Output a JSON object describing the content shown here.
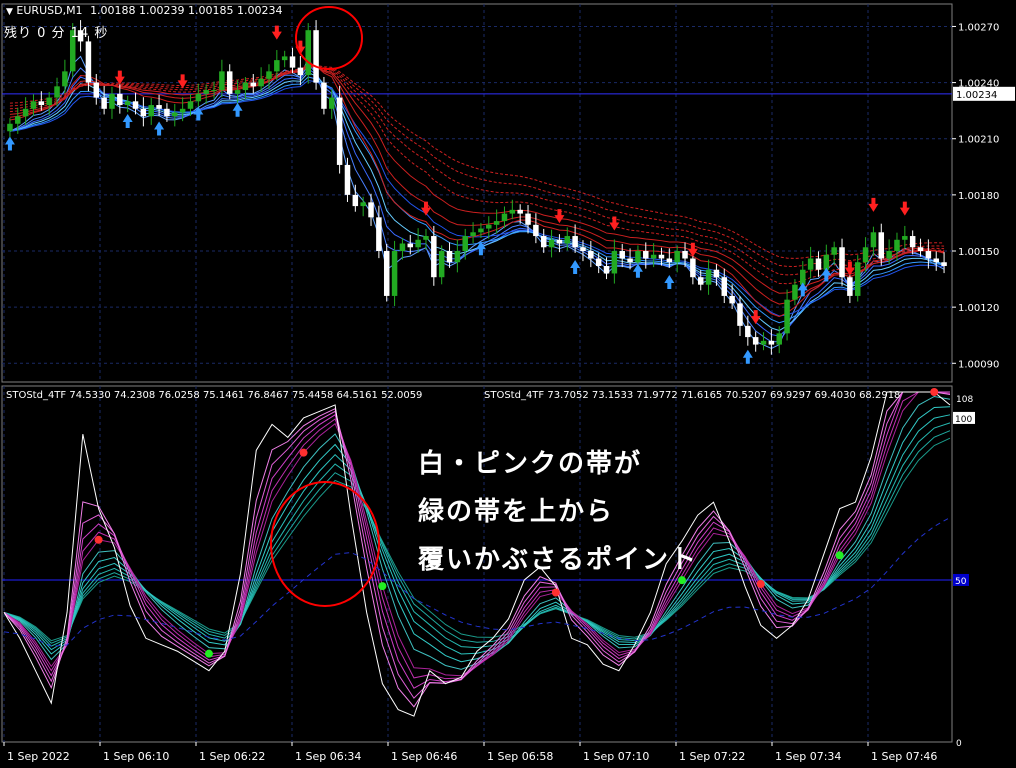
{
  "header": {
    "symbol": "EURUSD,M1",
    "ohlc": "1.00188 1.00239 1.00185 1.00234",
    "timer": "残り 0 分 14 秒"
  },
  "subwindow": {
    "label1": "STOStd_4TF 74.5330 74.2308 76.0258 75.1461 76.8467 75.4458 64.5161 52.0059",
    "label2": "STOStd_4TF 73.7052 73.1533 71.9772 71.6165 70.5207 69.9297 69.4030 68.2918"
  },
  "annotation": {
    "line1": "白・ピンクの帯が",
    "line2": "緑の帯を上から",
    "line3": "覆いかぶさるポイント"
  },
  "colors": {
    "bull": "#22aa22",
    "bear": "#ffffff",
    "grid": "#1a2a66",
    "sell_arrow": "#ff2020",
    "buy_arrow": "#3399ff",
    "circle": "#ff0000",
    "level50": "#2222ff"
  },
  "chart_data": [
    {
      "type": "candlestick",
      "symbol": "EURUSD",
      "timeframe": "M1",
      "price_axis_ticks": [
        "1.00270",
        "1.00240",
        "1.00210",
        "1.00180",
        "1.00150",
        "1.00120",
        "1.00090"
      ],
      "ylim": [
        1.0008,
        1.00282
      ],
      "current_price": "1.00234",
      "closes": [
        1.00218,
        1.00222,
        1.00226,
        1.0023,
        1.00228,
        1.00232,
        1.00238,
        1.00246,
        1.00268,
        1.00262,
        1.0024,
        1.00232,
        1.00226,
        1.00234,
        1.00228,
        1.0023,
        1.00226,
        1.00222,
        1.00228,
        1.00226,
        1.00222,
        1.00224,
        1.00226,
        1.0023,
        1.00234,
        1.00236,
        1.00236,
        1.00246,
        1.00234,
        1.00236,
        1.0024,
        1.00238,
        1.00242,
        1.00246,
        1.00252,
        1.00254,
        1.00248,
        1.00244,
        1.00268,
        1.0024,
        1.00226,
        1.00232,
        1.00196,
        1.0018,
        1.00174,
        1.00176,
        1.00168,
        1.0015,
        1.00126,
        1.0015,
        1.00154,
        1.00152,
        1.00156,
        1.00158,
        1.00136,
        1.0015,
        1.00144,
        1.0015,
        1.00158,
        1.0016,
        1.00162,
        1.00164,
        1.00166,
        1.0017,
        1.00172,
        1.0017,
        1.00164,
        1.00158,
        1.00152,
        1.00156,
        1.00154,
        1.00158,
        1.00152,
        1.0015,
        1.00146,
        1.00142,
        1.00138,
        1.0015,
        1.00146,
        1.00144,
        1.0015,
        1.00146,
        1.00148,
        1.00146,
        1.00144,
        1.0015,
        1.00146,
        1.00136,
        1.00132,
        1.0014,
        1.00136,
        1.00126,
        1.00122,
        1.0011,
        1.00104,
        1.001,
        1.00102,
        1.001,
        1.00106,
        1.00124,
        1.00132,
        1.0014,
        1.00146,
        1.0014,
        1.00148,
        1.00152,
        1.00136,
        1.00126,
        1.00144,
        1.00152,
        1.0016,
        1.00146,
        1.0015,
        1.00156,
        1.00158,
        1.00152,
        1.0015,
        1.00146,
        1.00144,
        1.00142
      ],
      "sell_arrow_bars": [
        14,
        22,
        34,
        37,
        53,
        70,
        77,
        87,
        95,
        107,
        110,
        114
      ],
      "buy_arrow_bars": [
        0,
        15,
        19,
        24,
        29,
        60,
        72,
        80,
        84,
        94,
        101,
        104
      ]
    },
    {
      "type": "line",
      "indicator": "STOStd_4TF",
      "levels": [
        100,
        50,
        0
      ],
      "axis_labels": [
        "108",
        "100",
        "50",
        "0"
      ],
      "x_tick_labels": [
        "1 Sep 2022",
        "1 Sep 06:10",
        "1 Sep 06:22",
        "1 Sep 06:34",
        "1 Sep 06:46",
        "1 Sep 06:58",
        "1 Sep 07:10",
        "1 Sep 07:22",
        "1 Sep 07:34",
        "1 Sep 07:46"
      ],
      "main": [
        40,
        32,
        22,
        12,
        40,
        95,
        72,
        60,
        42,
        32,
        30,
        28,
        25,
        22,
        28,
        52,
        90,
        98,
        94,
        100,
        102,
        104,
        70,
        40,
        18,
        10,
        8,
        22,
        18,
        20,
        28,
        32,
        38,
        50,
        54,
        48,
        32,
        30,
        24,
        22,
        30,
        40,
        55,
        62,
        70,
        74,
        62,
        48,
        36,
        32,
        36,
        44,
        58,
        72,
        74,
        88,
        112,
        122,
        118,
        112,
        104
      ]
    }
  ]
}
